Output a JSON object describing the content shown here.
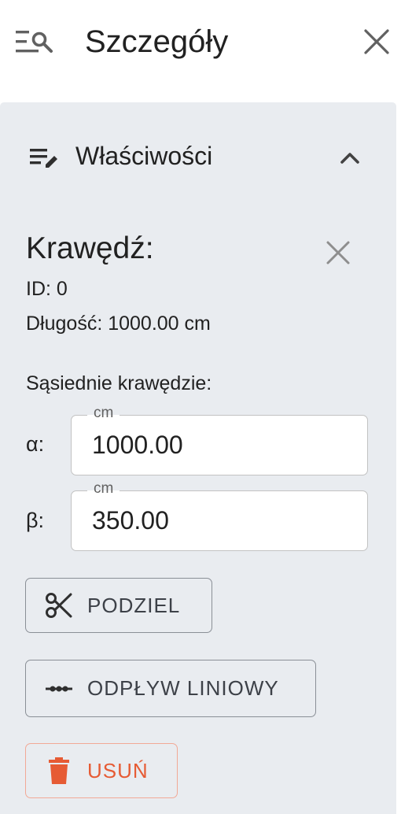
{
  "header": {
    "title": "Szczegóły"
  },
  "accordion": {
    "title": "Właściwości"
  },
  "edge": {
    "title": "Krawędź:",
    "id_text": "ID: 0",
    "length_text": "Długość: 1000.00 cm",
    "neighbors_label": "Sąsiednie krawędzie:"
  },
  "fields": [
    {
      "symbol": "α:",
      "legend": "cm",
      "value": "1000.00"
    },
    {
      "symbol": "β:",
      "legend": "cm",
      "value": "350.00"
    }
  ],
  "buttons": {
    "split": "PODZIEL",
    "linear_drain": "ODPŁYW LINIOWY",
    "delete": "USUŃ"
  },
  "colors": {
    "panel_bg": "#e9ecf0",
    "text": "#212121",
    "button_text": "#3d4148",
    "danger": "#e65b34",
    "danger_border": "#f2a996"
  },
  "icons": {
    "header_left": "search-list-icon",
    "header_close": "close-icon",
    "accordion_left": "edit-list-icon",
    "accordion_toggle": "chevron-up-icon",
    "edge_close": "close-icon",
    "split": "scissors-icon",
    "linear_drain": "dotted-line-icon",
    "delete": "trash-icon"
  }
}
